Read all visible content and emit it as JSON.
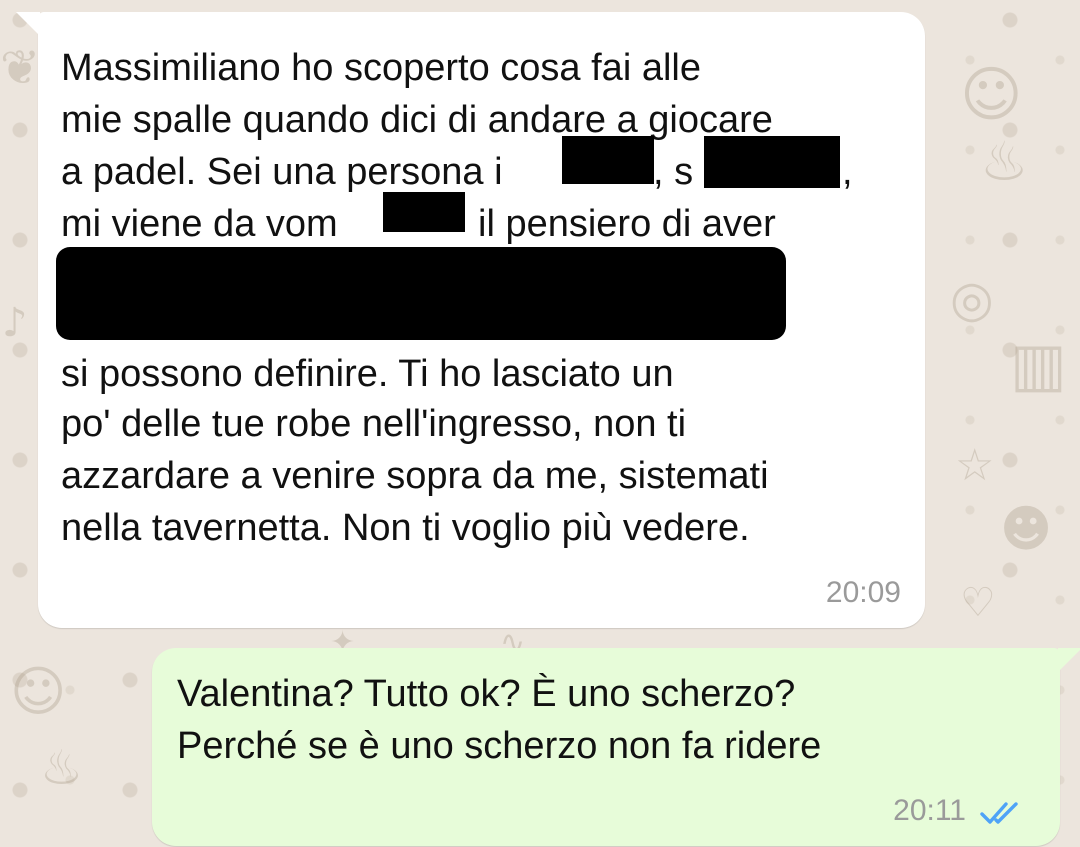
{
  "chat": {
    "incoming": {
      "lines": [
        "Massimiliano ho scoperto cosa fai alle",
        "mie spalle quando dici di andare a giocare",
        "a padel. Sei una persona i",
        ", s",
        ",",
        "mi viene da vom",
        "il pensiero di aver",
        "si possono definire. Ti ho lasciato un",
        "po' delle tue robe nell'ingresso, non ti",
        "azzardare a venire sopra da me, sistemati",
        "nella tavernetta. Non ti voglio più vedere."
      ],
      "time": "20:09"
    },
    "outgoing": {
      "lines": [
        "Valentina? Tutto ok? È uno scherzo?",
        "Perché se è uno scherzo non fa ridere"
      ],
      "time": "20:11",
      "status_icon": "double-check-read-icon",
      "status_color": "#4fa3f7"
    }
  },
  "colors": {
    "incoming_bubble": "#ffffff",
    "outgoing_bubble": "#e7fcd9",
    "wallpaper": "#ece5dd",
    "redaction": "#000000"
  }
}
